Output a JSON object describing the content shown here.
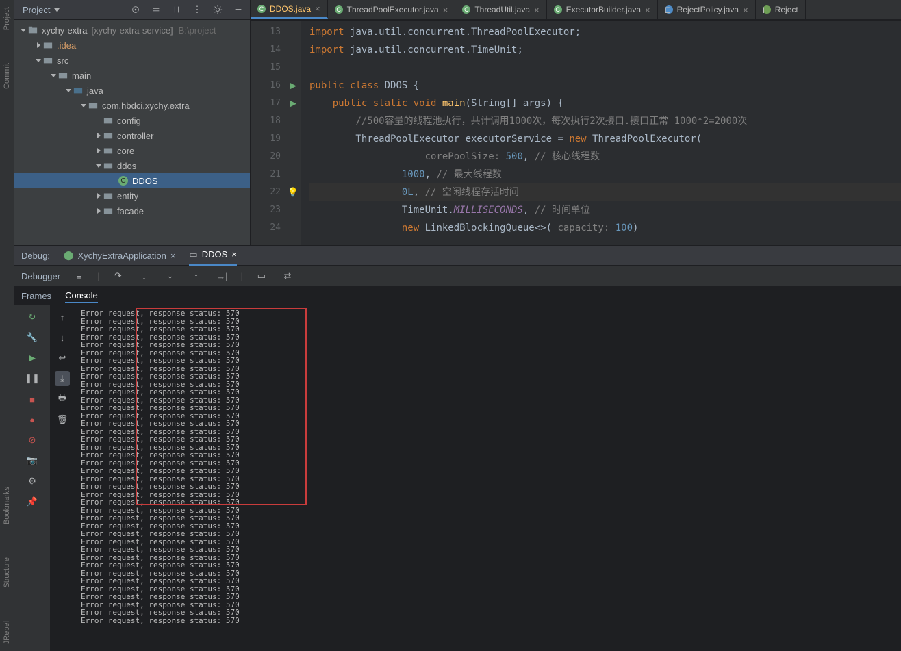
{
  "rail": {
    "project": "Project",
    "commit": "Commit",
    "bookmarks": "Bookmarks",
    "structure": "Structure",
    "jrebel": "JRebel"
  },
  "project_toolbar": {
    "title": "Project"
  },
  "tree": {
    "root_name": "xychy-extra",
    "root_qualifier": "[xychy-extra-service]",
    "root_path": "B:\\project",
    "idea": ".idea",
    "src": "src",
    "main": "main",
    "java": "java",
    "pkg": "com.hbdci.xychy.extra",
    "config": "config",
    "controller": "controller",
    "core": "core",
    "ddos": "ddos",
    "ddos_file": "DDOS",
    "entity": "entity",
    "facade": "facade"
  },
  "tabs": [
    {
      "label": "DDOS.java",
      "active": true,
      "icon": "c"
    },
    {
      "label": "ThreadPoolExecutor.java",
      "icon": "c"
    },
    {
      "label": "ThreadUtil.java",
      "icon": "c"
    },
    {
      "label": "ExecutorBuilder.java",
      "icon": "c"
    },
    {
      "label": "RejectPolicy.java",
      "icon": "e"
    },
    {
      "label": "Reject",
      "icon": "i",
      "partial": true
    }
  ],
  "gutter": [
    "13",
    "14",
    "15",
    "16",
    "17",
    "18",
    "19",
    "20",
    "21",
    "22",
    "23",
    "24"
  ],
  "code": {
    "l13": "import java.util.concurrent.ThreadPoolExecutor;",
    "l14": "import java.util.concurrent.TimeUnit;",
    "l15": "",
    "l16": "public class DDOS {",
    "l17": "    public static void main(String[] args) {",
    "l18": "        //500容量的线程池执行，共计调用1000次，每次执行2次接口.接口正常 1000*2=2000次",
    "l19_a": "ThreadPoolExecutor ",
    "l19_b": "executorService",
    "l19_c": " = ",
    "l19_d": "new ",
    "l19_e": "ThreadPoolExecutor(",
    "l20_a": "corePoolSize: ",
    "l20_b": "500",
    "l20_c": ", ",
    "l20_cm": "// 核心线程数",
    "l21_a": "1000",
    "l21_b": ", ",
    "l21_cm": "// 最大线程数",
    "l22_a": "0L",
    "l22_b": ", ",
    "l22_cm": "// 空闲线程存活时间",
    "l23_a": "TimeUnit.",
    "l23_b": "MILLISECONDS",
    "l23_c": ", ",
    "l23_cm": "// 时间单位",
    "l24_a": "new ",
    "l24_b": "LinkedBlockingQueue<>( ",
    "l24_c": "capacity: ",
    "l24_d": "100",
    "l24_e": ")"
  },
  "debug": {
    "head": "Debug:",
    "app_tab": "XychyExtraApplication",
    "ddos_tab": "DDOS",
    "debugger": "Debugger",
    "frames": "Frames",
    "console": "Console"
  },
  "console_line": "Error request, response status: 570",
  "console_count": 40
}
